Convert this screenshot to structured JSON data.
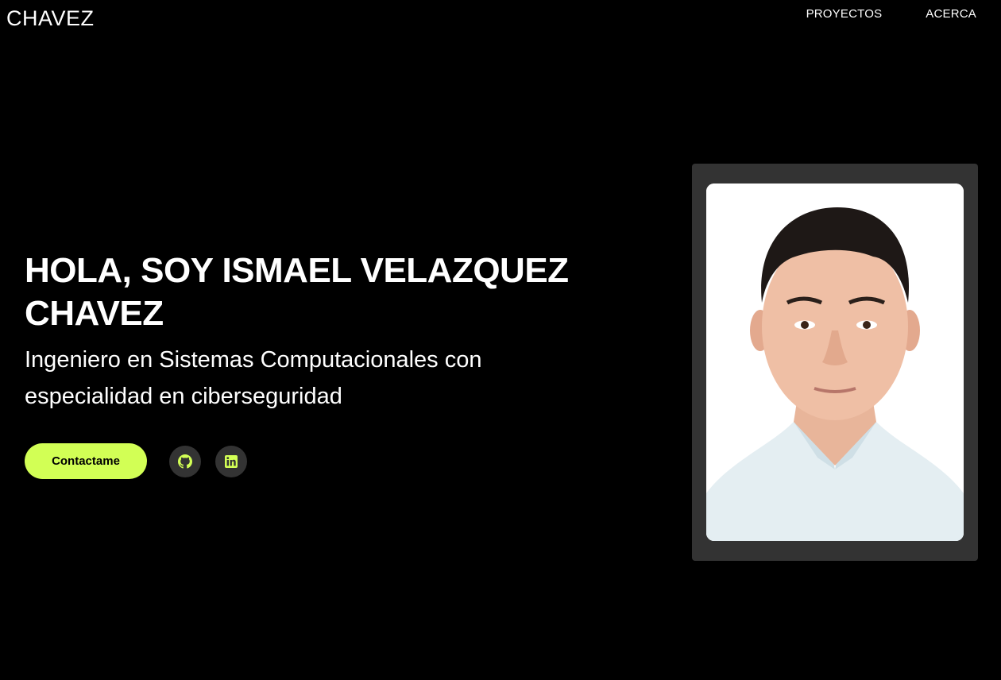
{
  "header": {
    "logo": "CHAVEZ",
    "nav": [
      {
        "label": "PROYECTOS"
      },
      {
        "label": "ACERCA"
      }
    ]
  },
  "hero": {
    "title": "HOLA, SOY ISMAEL VELAZQUEZ CHAVEZ",
    "subtitle": "Ingeniero en Sistemas Computacionales con especialidad en ciberseguridad",
    "contact_label": "Contactame",
    "social": [
      {
        "icon": "github-icon"
      },
      {
        "icon": "linkedin-icon"
      }
    ]
  },
  "colors": {
    "background": "#000000",
    "accent": "#d2ff55",
    "card": "#333333",
    "text": "#ffffff"
  }
}
